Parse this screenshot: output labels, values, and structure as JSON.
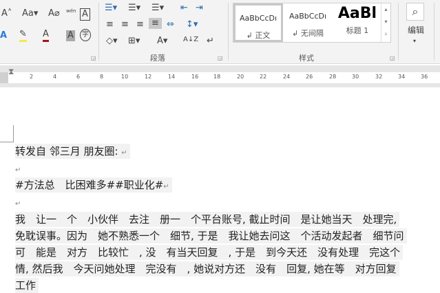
{
  "ribbon": {
    "font": {
      "grow": "A˄",
      "case": "Aa▾",
      "clear": "A⌀",
      "phonetic": "wén",
      "border_char": "A",
      "effects": "A",
      "highlight": "✎",
      "font_color": "A",
      "shade": "A",
      "enclose": "字"
    },
    "paragraph": {
      "label": "段落",
      "sort": "A↓Z"
    },
    "styles": {
      "label": "样式",
      "items": [
        {
          "preview": "AaBbCcDı",
          "name": "↲ 正文"
        },
        {
          "preview": "AaBbCcDı",
          "name": "↲ 无间隔"
        },
        {
          "preview": "AaBl",
          "name": "标题 1"
        }
      ]
    },
    "editing": {
      "label": "编辑"
    }
  },
  "ruler": {
    "ticks": [
      "2",
      "4",
      "6",
      "8",
      "10",
      "12",
      "14",
      "16",
      "18",
      "20",
      "22",
      "24",
      "26",
      "28",
      "30",
      "32",
      "34",
      "36"
    ]
  },
  "document": {
    "lines": [
      "转发自 邻三月 朋友圈:",
      "",
      "#方法总　比困难多##职业化#",
      "",
      "我　让一　个　小伙伴　去注　册一　个平台账号, 截止时间　是让她当天　处理完,",
      "免耽误事。因为　她不熟悉一个　细节, 于是　我让她去问这　个活动发起者　细节问",
      "可　能是　对方　比较忙　, 没　有当天回复　, 于是　到今天还　没有处理　完这个",
      "情, 然后我　今天问她处理　完没有　, 她说对方还　没有　回复, 她在等　对方回复",
      "工作"
    ],
    "para_mark": "↵"
  }
}
